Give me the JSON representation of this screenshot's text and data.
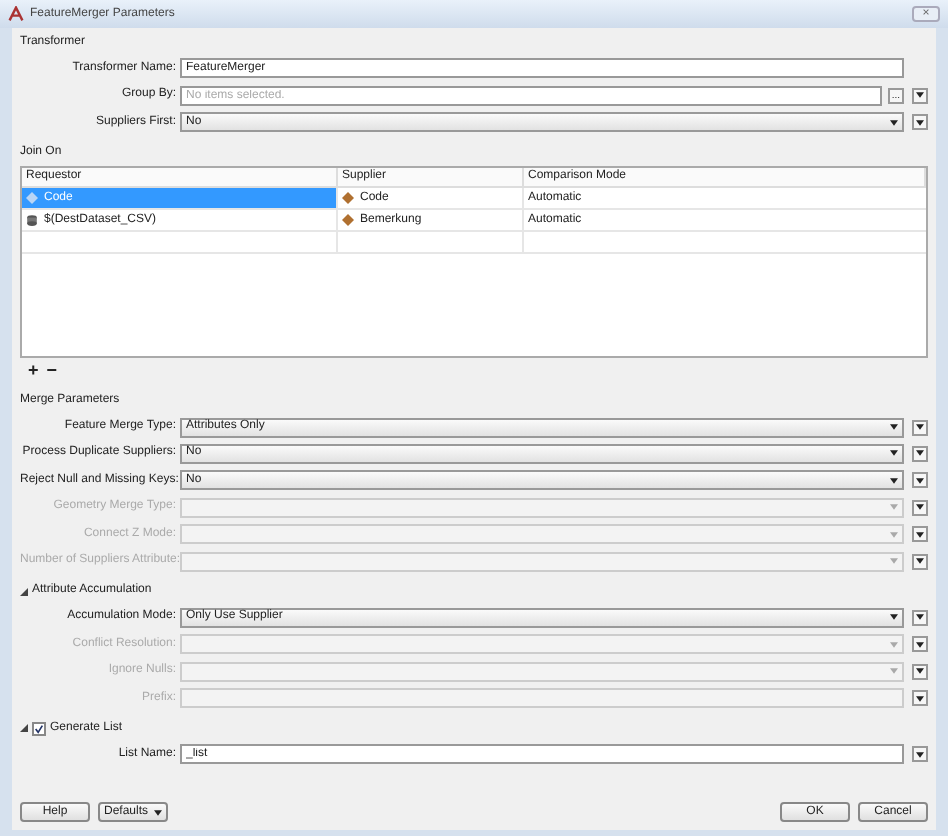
{
  "window": {
    "title": "FeatureMerger Parameters",
    "close": "×"
  },
  "transformer": {
    "label": "Transformer",
    "fields": [
      {
        "kind": "text",
        "label": "Transformer Name:",
        "value": "FeatureMerger",
        "disabled": false,
        "menu": false
      },
      {
        "kind": "picker",
        "label": "Group By:",
        "placeholder": "No items selected.",
        "browse": "...",
        "disabled": false,
        "menu": true
      },
      {
        "kind": "select",
        "label": "Suppliers First:",
        "value": "No",
        "disabled": false,
        "menu": true
      }
    ]
  },
  "join_on": {
    "label": "Join On",
    "columns": [
      "Requestor",
      "Supplier",
      "Comparison Mode"
    ],
    "rows": [
      {
        "requestor": "Code",
        "kind": "attribute",
        "supplier": "Code",
        "mode": "Automatic",
        "selected": true
      },
      {
        "requestor": "$(DestDataset_CSV)",
        "kind": "dataset",
        "supplier": "Bemerkung",
        "mode": "Automatic",
        "selected": false
      }
    ],
    "add": "+",
    "remove": "−"
  },
  "merge_parameters": {
    "label": "Merge Parameters",
    "fields": [
      {
        "kind": "select",
        "label": "Feature Merge Type:",
        "value": "Attributes Only",
        "disabled": false,
        "menu": true
      },
      {
        "kind": "select",
        "label": "Process Duplicate Suppliers:",
        "value": "No",
        "disabled": false,
        "menu": true
      },
      {
        "kind": "select",
        "label": "Reject Null and Missing Keys:",
        "value": "No",
        "disabled": false,
        "menu": true
      },
      {
        "kind": "select",
        "label": "Geometry Merge Type:",
        "disabled": true,
        "menu": true
      },
      {
        "kind": "select",
        "label": "Connect Z Mode:",
        "disabled": true,
        "menu": true
      },
      {
        "kind": "select",
        "label": "Number of Suppliers Attribute:",
        "disabled": true,
        "menu": true
      }
    ]
  },
  "attribute_accumulation": {
    "label": "Attribute Accumulation",
    "expanded": true,
    "fields": [
      {
        "kind": "select",
        "label": "Accumulation Mode:",
        "value": "Only Use Supplier",
        "disabled": false,
        "menu": true
      },
      {
        "kind": "select",
        "label": "Conflict Resolution:",
        "disabled": true,
        "menu": true
      },
      {
        "kind": "select",
        "label": "Ignore Nulls:",
        "disabled": true,
        "menu": true
      },
      {
        "kind": "text",
        "label": "Prefix:",
        "disabled": true,
        "menu": true
      }
    ]
  },
  "generate_list": {
    "label": "Generate List",
    "expanded": true,
    "checked": true,
    "fields": [
      {
        "kind": "text",
        "label": "List Name:",
        "value": "_list",
        "disabled": false,
        "menu": true
      }
    ]
  },
  "buttons": {
    "left": [
      {
        "label": "Help",
        "dropdown": false
      },
      {
        "label": "Defaults",
        "dropdown": true
      }
    ],
    "right": [
      {
        "label": "OK",
        "dropdown": false
      },
      {
        "label": "Cancel",
        "dropdown": false
      }
    ]
  }
}
